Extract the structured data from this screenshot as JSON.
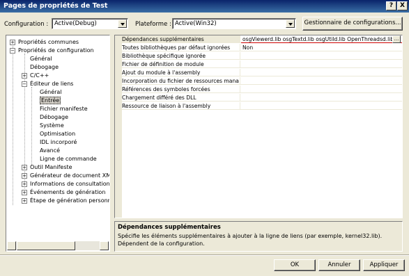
{
  "window": {
    "title": "Pages de propriétés de Test",
    "help_label": "?",
    "close_label": "X"
  },
  "config_bar": {
    "configuration_label": "Configuration :",
    "configuration_value": "Active(Debug)",
    "platform_label": "Plateforme :",
    "platform_value": "Active(Win32)",
    "manager_button": "Gestionnaire de configurations..."
  },
  "tree": [
    {
      "label": "Propriétés communes",
      "expander": "+"
    },
    {
      "label": "Propriétés de configuration",
      "expander": "−"
    },
    {
      "label": "Général"
    },
    {
      "label": "Débogage"
    },
    {
      "label": "C/C++",
      "expander": "+"
    },
    {
      "label": "Éditeur de liens",
      "expander": "−"
    },
    {
      "label": "Général"
    },
    {
      "label": "Entrée",
      "selected": true
    },
    {
      "label": "Fichier manifeste"
    },
    {
      "label": "Débogage"
    },
    {
      "label": "Système"
    },
    {
      "label": "Optimisation"
    },
    {
      "label": "IDL incorporé"
    },
    {
      "label": "Avancé"
    },
    {
      "label": "Ligne de commande"
    },
    {
      "label": "Outil Manifeste",
      "expander": "+"
    },
    {
      "label": "Générateur de document XM",
      "expander": "+"
    },
    {
      "label": "Informations de consultation",
      "expander": "+"
    },
    {
      "label": "Événements de génération",
      "expander": "+"
    },
    {
      "label": "Étape de génération personn",
      "expander": "+"
    }
  ],
  "properties": [
    {
      "name": "Dépendances supplémentaires",
      "value": "osgViewerd.lib osgTextd.lib osgUtild.lib OpenThreadsd.lib",
      "active": true
    },
    {
      "name": "Toutes bibliothèques par défaut ignorées",
      "value": "Non"
    },
    {
      "name": "Bibliothèque spécifique ignorée",
      "value": ""
    },
    {
      "name": "Fichier de définition de module",
      "value": ""
    },
    {
      "name": "Ajout du module à l'assembly",
      "value": ""
    },
    {
      "name": "Incorporation du fichier de ressources mana",
      "value": ""
    },
    {
      "name": "Références des symboles forcées",
      "value": ""
    },
    {
      "name": "Chargement différé des DLL",
      "value": ""
    },
    {
      "name": "Ressource de liaison à l'assembly",
      "value": ""
    }
  ],
  "ellipsis_label": "...",
  "description": {
    "title": "Dépendances supplémentaires",
    "text": "Spécifie les éléments supplémentaires à ajouter à la ligne de liens (par exemple, kernel32.lib). Dépendent de la configuration."
  },
  "buttons": {
    "ok": "OK",
    "cancel": "Annuler",
    "apply": "Appliquer"
  }
}
